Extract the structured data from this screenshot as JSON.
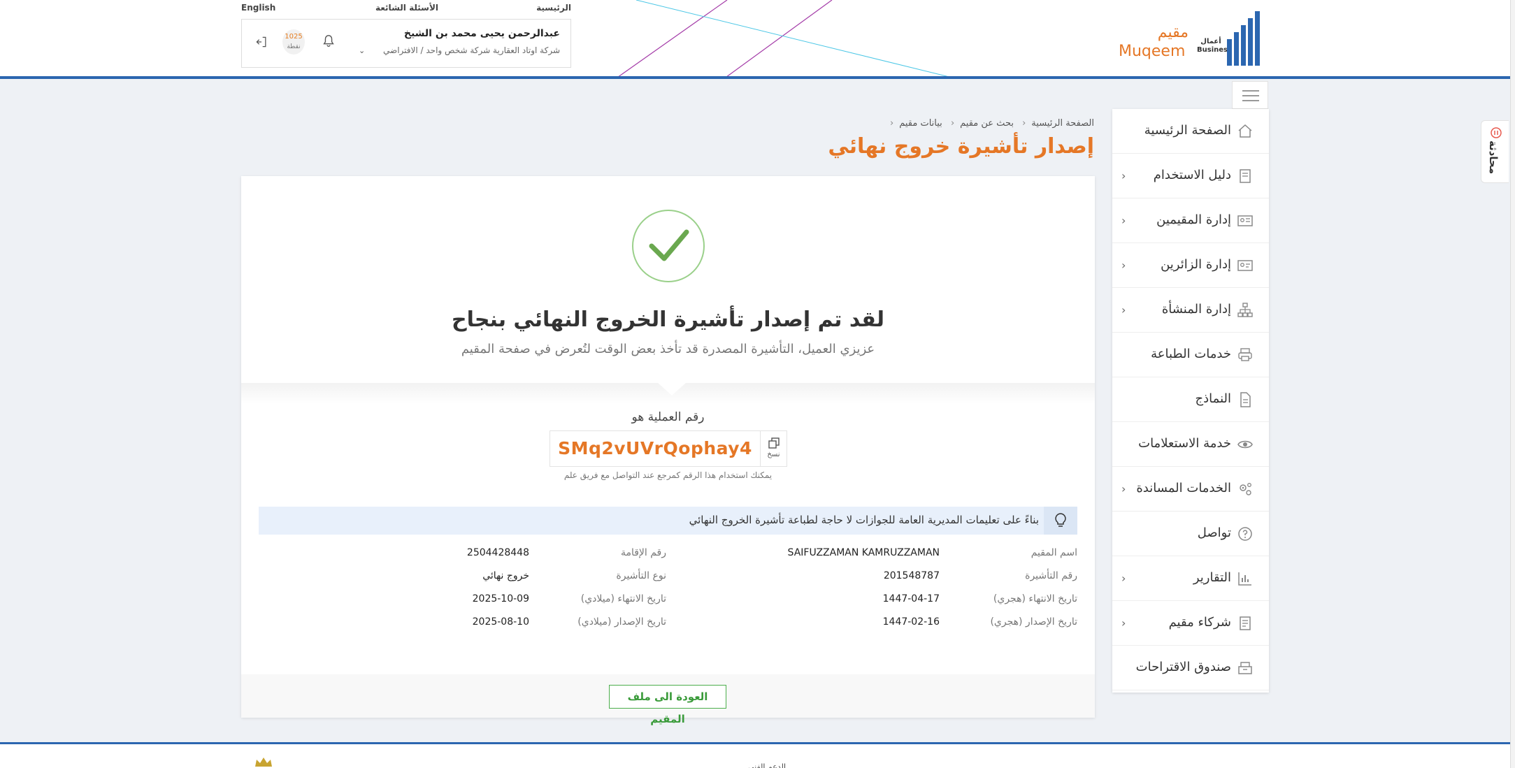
{
  "topnav": {
    "english": "English",
    "faq": "الأسئلة الشائعة",
    "home": "الرئيسية"
  },
  "user": {
    "name": "عبدالرحمن يحيى محمد بن الشيخ",
    "company": "شركة اوتاد العقارية شركة شخص واحد / الافتراضي",
    "points_value": "1025",
    "points_label": "نقطة"
  },
  "logo": {
    "muqeem_ar": "مقيم",
    "muqeem_en": "Muqeem",
    "business_ar": "أعمال",
    "business_en": "Business"
  },
  "colors": {
    "accent": "#e57726",
    "brand_blue": "#2b66b0",
    "success": "#6aa84f"
  },
  "sidebar": {
    "items": [
      {
        "label": "الصفحة الرئيسية",
        "icon": "home-icon",
        "has_children": false
      },
      {
        "label": "دليل الاستخدام",
        "icon": "book-icon",
        "has_children": true
      },
      {
        "label": "إدارة المقيمين",
        "icon": "id-card-icon",
        "has_children": true
      },
      {
        "label": "إدارة الزائرين",
        "icon": "visitor-card-icon",
        "has_children": true
      },
      {
        "label": "إدارة المنشأة",
        "icon": "org-chart-icon",
        "has_children": true
      },
      {
        "label": "خدمات الطباعة",
        "icon": "printer-icon",
        "has_children": false
      },
      {
        "label": "النماذج",
        "icon": "document-icon",
        "has_children": false
      },
      {
        "label": "خدمة الاستعلامات",
        "icon": "eye-icon",
        "has_children": false
      },
      {
        "label": "الخدمات المساندة",
        "icon": "gears-icon",
        "has_children": true
      },
      {
        "label": "تواصل",
        "icon": "question-icon",
        "has_children": false
      },
      {
        "label": "التقارير",
        "icon": "chart-icon",
        "has_children": true
      },
      {
        "label": "شركاء مقيم",
        "icon": "partners-icon",
        "has_children": true
      },
      {
        "label": "صندوق الاقتراحات",
        "icon": "suggestion-box-icon",
        "has_children": false
      }
    ]
  },
  "feedback": {
    "label": "محادثة"
  },
  "breadcrumb": {
    "items": [
      "الصفحة الرئيسية",
      "بحث عن مقيم",
      "بيانات مقيم"
    ]
  },
  "page": {
    "title": "إصدار تأشيرة خروج نهائي"
  },
  "result": {
    "title": "لقد تم إصدار تأشيرة الخروج النهائي بنجاح",
    "subtitle": "عزيزي العميل، التأشيرة المصدرة قد تأخذ بعض الوقت لتُعرض في صفحة المقيم",
    "operation_label": "رقم العملية هو",
    "operation_number": "SMq2vUVrQophay4",
    "copy_label": "نسخ",
    "operation_hint": "يمكنك استخدام هذا الرقم كمرجع عند التواصل مع فريق علم",
    "info": "بناءً على تعليمات المديرية العامة للجوازات لا حاجة لطباعة تأشيرة الخروج النهائي"
  },
  "details": {
    "rows": [
      {
        "right_label": "اسم المقيم",
        "right_value": "SAIFUZZAMAN KAMRUZZAMAN",
        "left_label": "رقم الإقامة",
        "left_value": "2504428448"
      },
      {
        "right_label": "رقم التأشيرة",
        "right_value": "201548787",
        "left_label": "نوع التأشيرة",
        "left_value": "خروج نهائي"
      },
      {
        "right_label": "تاريخ الانتهاء (هجري)",
        "right_value": "1447-04-17",
        "left_label": "تاريخ الانتهاء (ميلادي)",
        "left_value": "2025-10-09"
      },
      {
        "right_label": "تاريخ الإصدار (هجري)",
        "right_value": "1447-02-16",
        "left_label": "تاريخ الإصدار (ميلادي)",
        "left_value": "2025-08-10"
      }
    ]
  },
  "actions": {
    "back_label": "العودة الى ملف المقيم"
  },
  "footer": {
    "text": "الدعم الفني"
  }
}
